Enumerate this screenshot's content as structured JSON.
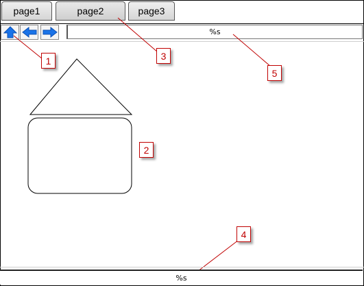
{
  "tabs": [
    {
      "label": "page1",
      "selected": false
    },
    {
      "label": "page2",
      "selected": true
    },
    {
      "label": "page3",
      "selected": false
    }
  ],
  "nav": {
    "up_icon": "arrow-up-icon",
    "back_icon": "arrow-left-icon",
    "forward_icon": "arrow-right-icon",
    "icon_color": "#1a73e8"
  },
  "address": {
    "value": "%s"
  },
  "status": {
    "value": "%s"
  },
  "callouts": {
    "one": "1",
    "two": "2",
    "three": "3",
    "four": "4",
    "five": "5",
    "color": "#c00000"
  }
}
